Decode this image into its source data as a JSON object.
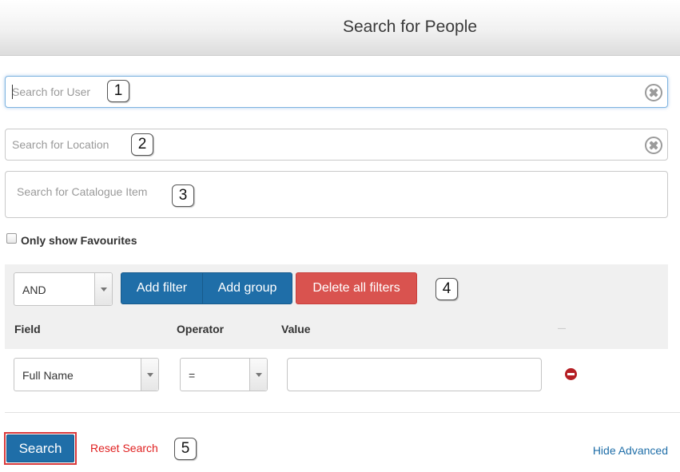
{
  "header": {
    "title": "Search for People"
  },
  "search_user": {
    "placeholder": "Search for User",
    "callout": "1"
  },
  "search_location": {
    "placeholder": "Search for Location",
    "callout": "2"
  },
  "search_catalogue": {
    "placeholder": "Search for Catalogue Item",
    "callout": "3"
  },
  "favourites": {
    "label": "Only show Favourites",
    "checked": false
  },
  "filters": {
    "logic_value": "AND",
    "add_filter_label": "Add filter",
    "add_group_label": "Add group",
    "delete_all_label": "Delete all filters",
    "callout": "4",
    "columns": {
      "field": "Field",
      "operator": "Operator",
      "value": "Value"
    },
    "row": {
      "field": "Full Name",
      "operator": "=",
      "value": ""
    }
  },
  "footer": {
    "search_label": "Search",
    "reset_label": "Reset Search",
    "callout": "5",
    "hide_advanced_label": "Hide Advanced"
  },
  "colors": {
    "primary_blue": "#1f6ea8",
    "danger_red": "#d9534f",
    "link_red": "#e02020",
    "highlight_outline": "#d8383a"
  }
}
